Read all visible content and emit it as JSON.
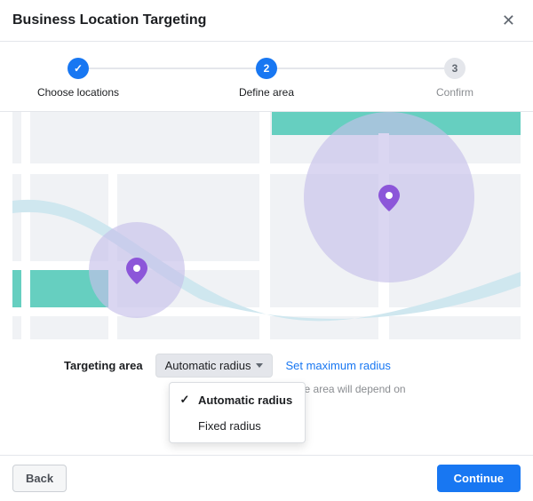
{
  "header": {
    "title": "Business Location Targeting"
  },
  "stepper": {
    "steps": [
      {
        "label": "Choose locations",
        "indicator": "✓",
        "state": "done"
      },
      {
        "label": "Define area",
        "indicator": "2",
        "state": "active"
      },
      {
        "label": "Confirm",
        "indicator": "3",
        "state": "pending"
      }
    ]
  },
  "config": {
    "label": "Targeting area",
    "selected_option": "Automatic radius",
    "set_max_link": "Set maximum radius",
    "helper_text": "your locations. The size of the area will depend on",
    "dropdown": {
      "options": [
        {
          "label": "Automatic radius",
          "selected": true
        },
        {
          "label": "Fixed radius",
          "selected": false
        }
      ]
    }
  },
  "footer": {
    "back": "Back",
    "continue": "Continue"
  },
  "colors": {
    "accent": "#1877f2",
    "map_road": "#ffffff",
    "map_bg": "#f0f2f5",
    "map_river": "#abd7e8",
    "map_park": "#41c7b2",
    "radius_fill": "#b9b3e6",
    "pin": "#8c56d9"
  }
}
